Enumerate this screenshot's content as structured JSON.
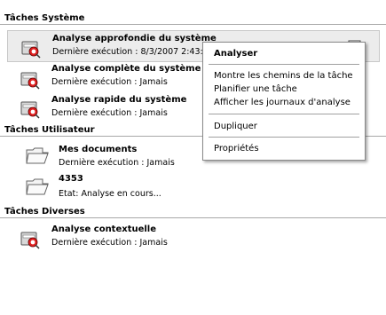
{
  "sections": {
    "system": "Tâches Système",
    "user": "Tâches Utilisateur",
    "misc": "Tâches Diverses"
  },
  "system_tasks": [
    {
      "title": "Analyse approfondie du système",
      "sub": "Dernière exécution : 8/3/2007 2:43:"
    },
    {
      "title": "Analyse complète du système",
      "sub": "Dernière exécution : Jamais"
    },
    {
      "title": "Analyse rapide du système",
      "sub": "Dernière exécution : Jamais"
    }
  ],
  "user_tasks": [
    {
      "title": "Mes documents",
      "sub": "Dernière exécution : Jamais"
    },
    {
      "title": "4353",
      "sub": "Etat:  Analyse en cours..."
    }
  ],
  "misc_tasks": [
    {
      "title": "Analyse contextuelle",
      "sub": "Dernière exécution : Jamais"
    }
  ],
  "context_menu": {
    "analyze": "Analyser",
    "show_paths": "Montre les chemins de la tâche",
    "schedule": "Planifier une tâche",
    "show_logs": "Afficher les journaux d'analyse",
    "duplicate": "Dupliquer",
    "properties": "Propriétés"
  },
  "icons": {
    "scan_task": "scan-disk-icon",
    "folder_task": "folder-icon",
    "run": "run-scan-icon"
  }
}
